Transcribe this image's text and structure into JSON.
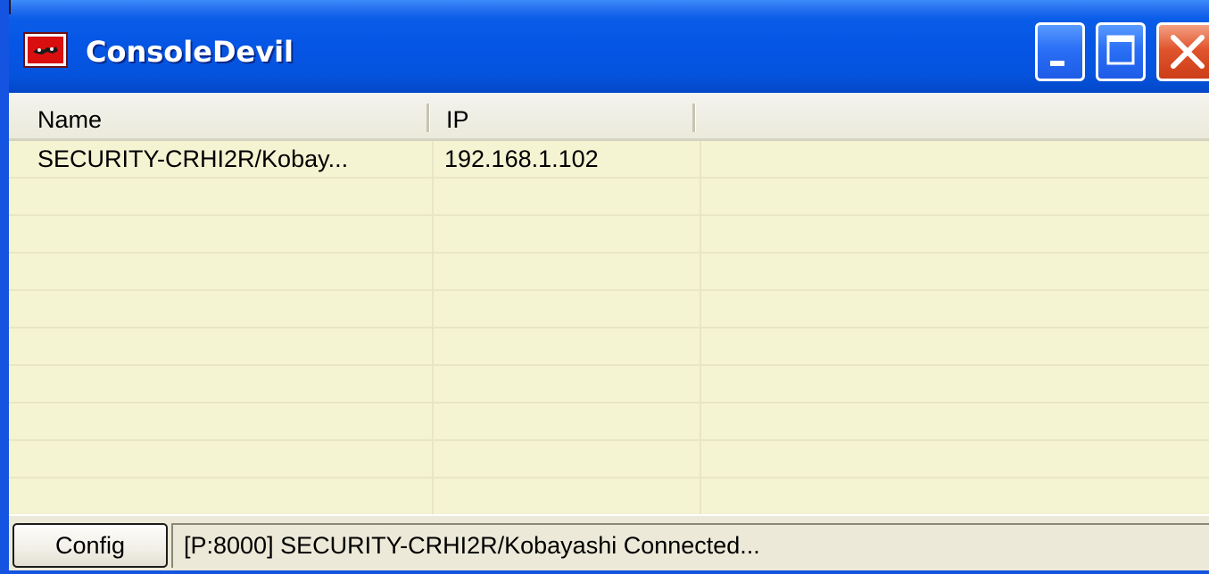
{
  "window": {
    "title": "ConsoleDevil"
  },
  "list": {
    "columns": [
      {
        "label": "Name"
      },
      {
        "label": "IP"
      }
    ],
    "rows": [
      {
        "name": "SECURITY-CRHI2R/Kobay...",
        "ip": "192.168.1.102"
      }
    ]
  },
  "footer": {
    "config_label": "Config",
    "status": "[P:8000] SECURITY-CRHI2R/Kobayashi Connected..."
  },
  "icons": {
    "app": "console-devil-app-icon",
    "minimize": "minimize-icon",
    "maximize": "maximize-icon",
    "close": "close-icon"
  },
  "colors": {
    "titlebar": "#0655e5",
    "list_background": "#f4f3d2",
    "close_button": "#e0552d"
  }
}
